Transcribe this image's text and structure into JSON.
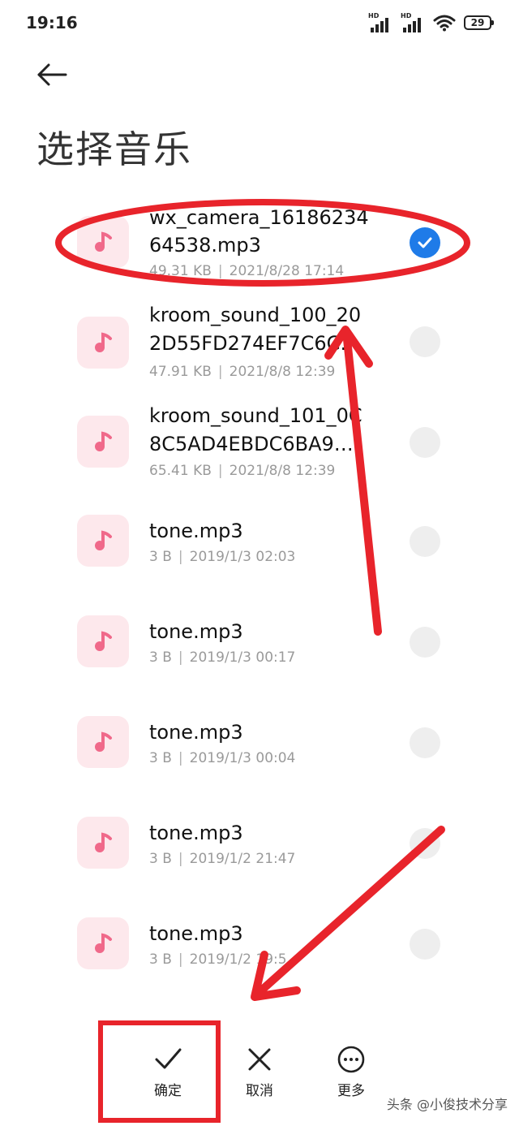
{
  "status_bar": {
    "time": "19:16",
    "signal_label_1": "HD",
    "signal_label_2": "HD",
    "battery": "29",
    "icons": [
      "hd-signal-icon",
      "hd-signal-icon",
      "wifi-icon",
      "battery-icon"
    ]
  },
  "header": {
    "back_icon": "back-arrow-icon",
    "title": "选择音乐"
  },
  "files": [
    {
      "name_line1": "wx_camera_16186234",
      "name_line2": "64538.mp3",
      "size": "49.31 KB",
      "separator": "|",
      "date": "2021/8/28 17:14",
      "selected": true,
      "icon": "music-note-icon"
    },
    {
      "name_line1": "kroom_sound_100_20",
      "name_line2": "2D55FD274EF7C6C…",
      "size": "47.91 KB",
      "separator": "|",
      "date": "2021/8/8 12:39",
      "selected": false,
      "icon": "music-note-icon"
    },
    {
      "name_line1": "kroom_sound_101_0C",
      "name_line2": "8C5AD4EBDC6BA9…",
      "size": "65.41 KB",
      "separator": "|",
      "date": "2021/8/8 12:39",
      "selected": false,
      "icon": "music-note-icon"
    },
    {
      "name_line1": "tone.mp3",
      "size": "3 B",
      "separator": "|",
      "date": "2019/1/3 02:03",
      "selected": false,
      "icon": "music-note-icon"
    },
    {
      "name_line1": "tone.mp3",
      "size": "3 B",
      "separator": "|",
      "date": "2019/1/3 00:17",
      "selected": false,
      "icon": "music-note-icon"
    },
    {
      "name_line1": "tone.mp3",
      "size": "3 B",
      "separator": "|",
      "date": "2019/1/3 00:04",
      "selected": false,
      "icon": "music-note-icon"
    },
    {
      "name_line1": "tone.mp3",
      "size": "3 B",
      "separator": "|",
      "date": "2019/1/2 21:47",
      "selected": false,
      "icon": "music-note-icon"
    },
    {
      "name_line1": "tone.mp3",
      "size": "3 B",
      "separator": "|",
      "date": "2019/1/2 19:5",
      "selected": false,
      "icon": "music-note-icon"
    }
  ],
  "bottom_bar": {
    "confirm": {
      "label": "确定",
      "icon": "checkmark-icon"
    },
    "cancel": {
      "label": "取消",
      "icon": "close-icon"
    },
    "more": {
      "label": "更多",
      "icon": "more-dots-icon"
    }
  },
  "watermark": "头条 @小俊技术分享",
  "colors": {
    "accent": "#1f7be8",
    "annotation_red": "#e8242b",
    "icon_bg": "#fde8ec",
    "icon_fg": "#f0698a",
    "meta_text": "#9a9a9a"
  }
}
